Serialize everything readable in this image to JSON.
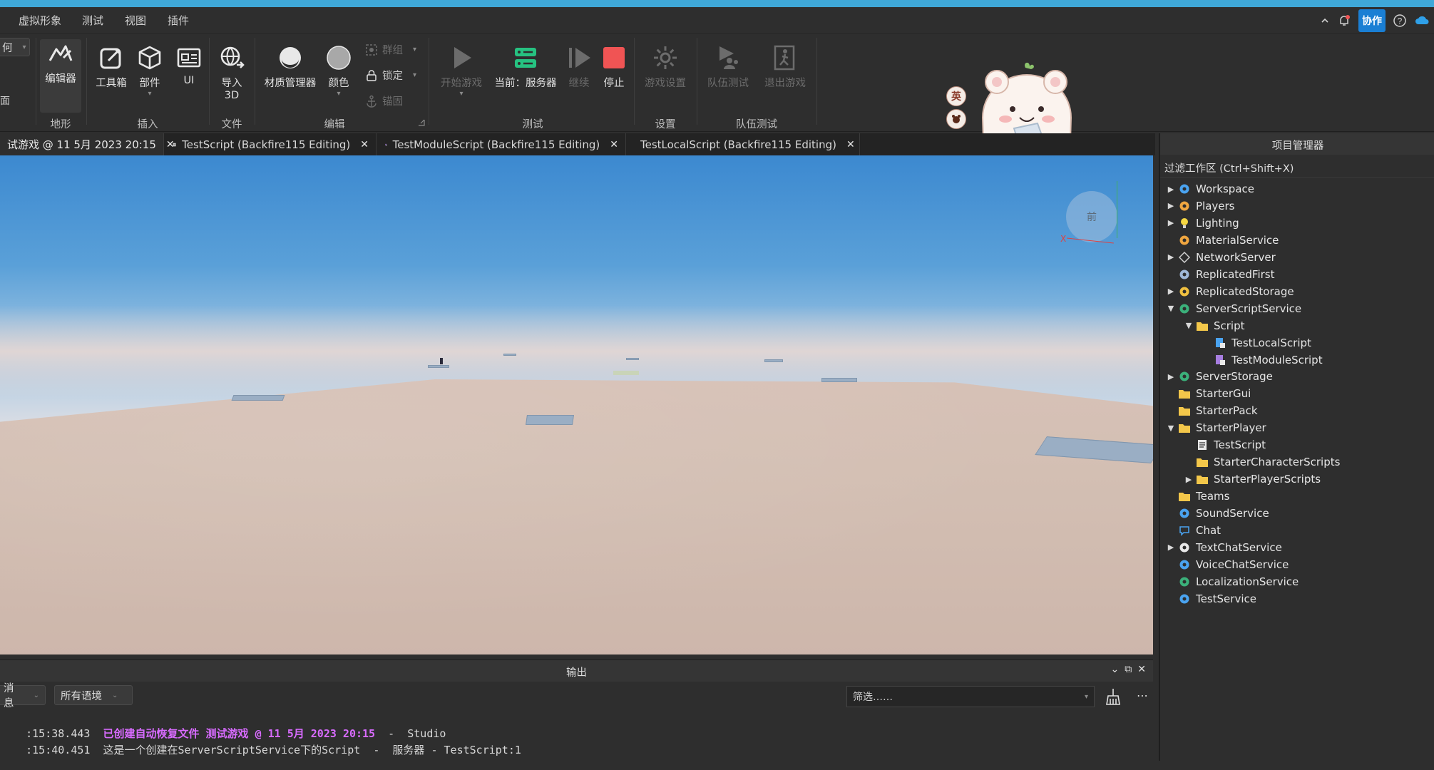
{
  "menubar": {
    "items": [
      "虚拟形象",
      "测试",
      "视图",
      "插件"
    ],
    "collab_label": "协作"
  },
  "ribbon": {
    "left_cut_labels": [
      "何",
      "面"
    ],
    "terrain": {
      "editor_label": "编辑器",
      "group_label": "地形"
    },
    "insert": {
      "toolbox_label": "工具箱",
      "part_label": "部件",
      "ui_label": "UI",
      "group_label": "插入"
    },
    "file": {
      "import_label_1": "导入",
      "import_label_2": "3D",
      "group_label": "文件"
    },
    "edit": {
      "material_label": "材质管理器",
      "color_label": "颜色",
      "group_sm_label": "群组",
      "lock_label": "锁定",
      "anchor_label": "锚固",
      "group_label": "编辑"
    },
    "test": {
      "play_label": "开始游戏",
      "current_label": "当前：服务器",
      "resume_label": "继续",
      "stop_label": "停止",
      "group_label": "测试"
    },
    "settings": {
      "game_settings_label": "游戏设置",
      "group_label": "设置"
    },
    "team": {
      "team_test_label": "队伍测试",
      "exit_game_label": "退出游戏",
      "group_label": "队伍测试"
    },
    "ime_labels": [
      "英"
    ]
  },
  "tabs": [
    {
      "label": "试游戏 @ 11 5月 2023 20:15",
      "active": true
    },
    {
      "label": "TestScript (Backfire115 Editing)"
    },
    {
      "label": "TestModuleScript (Backfire115 Editing)"
    },
    {
      "label": "TestLocalScript (Backfire115 Editing)"
    }
  ],
  "viewport": {
    "nav_cube_label": "前",
    "axis_x_label": "X"
  },
  "output": {
    "title": "输出",
    "messages_dropdown": "消息",
    "context_dropdown": "所有语境",
    "filter_placeholder": "筛选……",
    "logs": [
      {
        "time": ":15:38.443",
        "text": "已创建自动恢复文件 测试游戏 @ 11 5月 2023 20:15",
        "suffix": "  -  Studio",
        "highlight": true
      },
      {
        "time": ":15:40.451",
        "text": "这是一个创建在ServerScriptService下的Script",
        "suffix": "  -  服务器 - TestScript:1",
        "highlight": false
      }
    ]
  },
  "explorer": {
    "title": "项目管理器",
    "filter_label": "过滤工作区 (Ctrl+Shift+X)",
    "items": [
      {
        "label": "Workspace",
        "depth": 0,
        "arrow": "right",
        "icon": "globe-icon"
      },
      {
        "label": "Players",
        "depth": 0,
        "arrow": "right",
        "icon": "players-icon"
      },
      {
        "label": "Lighting",
        "depth": 0,
        "arrow": "right",
        "icon": "bulb-icon"
      },
      {
        "label": "MaterialService",
        "depth": 0,
        "arrow": "none",
        "icon": "material-icon"
      },
      {
        "label": "NetworkServer",
        "depth": 0,
        "arrow": "right",
        "icon": "network-icon"
      },
      {
        "label": "ReplicatedFirst",
        "depth": 0,
        "arrow": "none",
        "icon": "replicated-first-icon"
      },
      {
        "label": "ReplicatedStorage",
        "depth": 0,
        "arrow": "right",
        "icon": "replicated-storage-icon"
      },
      {
        "label": "ServerScriptService",
        "depth": 0,
        "arrow": "down",
        "icon": "server-script-service-icon"
      },
      {
        "label": "Script",
        "depth": 1,
        "arrow": "down",
        "icon": "folder-icon"
      },
      {
        "label": "TestLocalScript",
        "depth": 2,
        "arrow": "none",
        "icon": "local-script-icon"
      },
      {
        "label": "TestModuleScript",
        "depth": 2,
        "arrow": "none",
        "icon": "module-script-icon"
      },
      {
        "label": "ServerStorage",
        "depth": 0,
        "arrow": "right",
        "icon": "server-storage-icon"
      },
      {
        "label": "StarterGui",
        "depth": 0,
        "arrow": "none",
        "icon": "starter-gui-icon"
      },
      {
        "label": "StarterPack",
        "depth": 0,
        "arrow": "none",
        "icon": "starter-pack-icon"
      },
      {
        "label": "StarterPlayer",
        "depth": 0,
        "arrow": "down",
        "icon": "starter-player-icon"
      },
      {
        "label": "TestScript",
        "depth": 1,
        "arrow": "none",
        "icon": "script-icon"
      },
      {
        "label": "StarterCharacterScripts",
        "depth": 1,
        "arrow": "none",
        "icon": "starter-character-scripts-icon"
      },
      {
        "label": "StarterPlayerScripts",
        "depth": 1,
        "arrow": "right",
        "icon": "starter-player-scripts-icon"
      },
      {
        "label": "Teams",
        "depth": 0,
        "arrow": "none",
        "icon": "teams-icon"
      },
      {
        "label": "SoundService",
        "depth": 0,
        "arrow": "none",
        "icon": "sound-icon"
      },
      {
        "label": "Chat",
        "depth": 0,
        "arrow": "none",
        "icon": "chat-icon"
      },
      {
        "label": "TextChatService",
        "depth": 0,
        "arrow": "right",
        "icon": "text-chat-icon"
      },
      {
        "label": "VoiceChatService",
        "depth": 0,
        "arrow": "none",
        "icon": "voice-chat-icon"
      },
      {
        "label": "LocalizationService",
        "depth": 0,
        "arrow": "none",
        "icon": "localization-icon"
      },
      {
        "label": "TestService",
        "depth": 0,
        "arrow": "none",
        "icon": "test-service-icon"
      }
    ]
  },
  "colors": {
    "accent": "#3fa8d8",
    "stop_red": "#f05454",
    "server_green": "#26c281",
    "log_highlight": "#d86bff",
    "collab_blue": "#1a7fd4"
  }
}
